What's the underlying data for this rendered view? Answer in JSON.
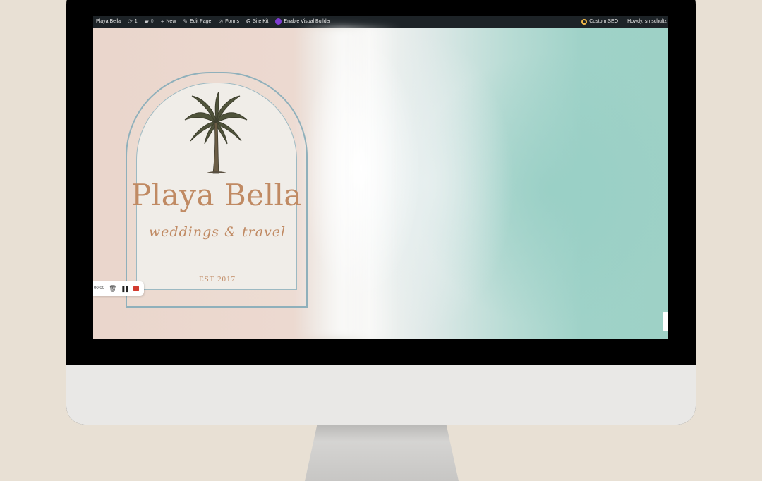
{
  "admin_bar": {
    "site_name": "Playa Bella",
    "updates_count": "1",
    "comments_count": "0",
    "new_label": "New",
    "edit_page_label": "Edit Page",
    "forms_label": "Forms",
    "site_kit_label": "Site Kit",
    "visual_builder_label": "Enable Visual Builder",
    "custom_seo_label": "Custom SEO",
    "howdy_label": "Howdy, smschultz"
  },
  "hero": {
    "brand_name": "Playa Bella",
    "tagline": "weddings & travel",
    "established": "EST 2017"
  },
  "recorder": {
    "timer": "00:00"
  },
  "icons": {
    "updates": "refresh-icon",
    "comments": "comment-icon",
    "new": "plus-icon",
    "edit": "pencil-icon",
    "forms": "forms-icon",
    "site_kit": "google-g-icon",
    "visual_builder": "divi-icon",
    "seo": "seo-icon"
  },
  "colors": {
    "admin_bar_bg": "#1d2327",
    "brand_text": "#c08a63",
    "arch_border": "#8fb0bb",
    "record_red": "#d23b2f"
  }
}
